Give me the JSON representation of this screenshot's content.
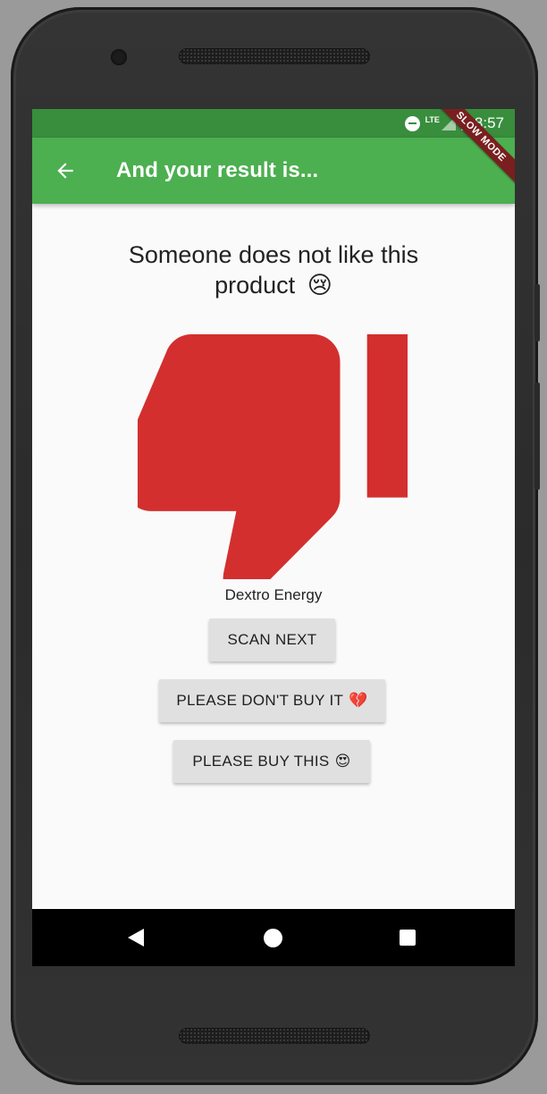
{
  "status_bar": {
    "network_label": "LTE",
    "time": "8:57",
    "dnd_icon": "do-not-disturb-icon",
    "signal_icon": "signal-icon",
    "battery_icon": "battery-charging-icon",
    "battery_glyph": "ϟ"
  },
  "debug_banner": {
    "label": "SLOW MODE"
  },
  "app_bar": {
    "back_icon": "arrow-back-icon",
    "title": "And your result is..."
  },
  "result": {
    "message": "Someone does not like this product",
    "message_emoji": "😢",
    "icon": "thumb-down-icon",
    "icon_color": "#d32f2f",
    "product_name": "Dextro Energy"
  },
  "buttons": {
    "scan_next": "SCAN NEXT",
    "dont_buy": "PLEASE DON'T BUY IT",
    "dont_buy_emoji": "💔",
    "buy": "PLEASE BUY THIS",
    "buy_emoji": "😍"
  },
  "nav_bar": {
    "back_icon": "nav-back-icon",
    "home_icon": "nav-home-icon",
    "recents_icon": "nav-recents-icon"
  },
  "colors": {
    "primary": "#4caf50",
    "primary_dark": "#388e3c",
    "accent_red": "#d32f2f",
    "background": "#fafafa",
    "button_bg": "#e0e0e0"
  }
}
